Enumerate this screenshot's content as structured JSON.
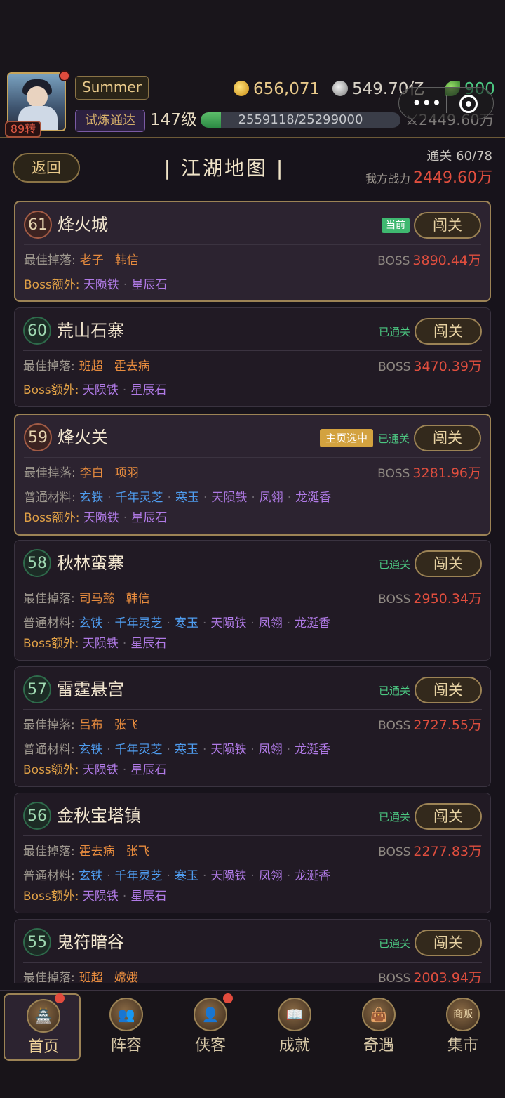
{
  "header": {
    "username": "Summer",
    "reborn": "89转",
    "badge": "试炼通达",
    "level": "147级",
    "xp_text": "2559118/25299000",
    "xp_fraction": 0.1,
    "gold": "656,071",
    "silver": "549.70亿",
    "jade": "900",
    "power": "2449.60万"
  },
  "title_row": {
    "back_label": "返回",
    "title": "| 江湖地图 |",
    "cleared": "通关 60/78",
    "my_power_label": "我方战力",
    "my_power_value": "2449.60万"
  },
  "labels": {
    "best_drop": "最佳掉落:",
    "boss": "BOSS",
    "boss_extra": "Boss额外:",
    "common_mat": "普通材料:",
    "fight": "闯关",
    "tag_current": "当前",
    "tag_home": "主页选中",
    "tag_cleared": "已通关"
  },
  "stages": [
    {
      "num": "61",
      "name": "烽火城",
      "drops": [
        "老子",
        "韩信"
      ],
      "boss": "3890.44万",
      "boss_extra": [
        "天陨铁",
        "星辰石"
      ]
    },
    {
      "num": "60",
      "name": "荒山石寨",
      "drops": [
        "班超",
        "霍去病"
      ],
      "boss": "3470.39万",
      "boss_extra": [
        "天陨铁",
        "星辰石"
      ]
    },
    {
      "num": "59",
      "name": "烽火关",
      "drops": [
        "李白",
        "项羽"
      ],
      "boss": "3281.96万",
      "materials": [
        "玄铁",
        "千年灵芝",
        "寒玉",
        "天陨铁",
        "凤翎",
        "龙涎香"
      ],
      "boss_extra": [
        "天陨铁",
        "星辰石"
      ]
    },
    {
      "num": "58",
      "name": "秋林蛮寨",
      "drops": [
        "司马懿",
        "韩信"
      ],
      "boss": "2950.34万",
      "materials": [
        "玄铁",
        "千年灵芝",
        "寒玉",
        "天陨铁",
        "凤翎",
        "龙涎香"
      ],
      "boss_extra": [
        "天陨铁",
        "星辰石"
      ]
    },
    {
      "num": "57",
      "name": "雷霆悬宫",
      "drops": [
        "吕布",
        "张飞"
      ],
      "boss": "2727.55万",
      "materials": [
        "玄铁",
        "千年灵芝",
        "寒玉",
        "天陨铁",
        "凤翎",
        "龙涎香"
      ],
      "boss_extra": [
        "天陨铁",
        "星辰石"
      ]
    },
    {
      "num": "56",
      "name": "金秋宝塔镇",
      "drops": [
        "霍去病",
        "张飞"
      ],
      "boss": "2277.83万",
      "materials": [
        "玄铁",
        "千年灵芝",
        "寒玉",
        "天陨铁",
        "凤翎",
        "龙涎香"
      ],
      "boss_extra": [
        "天陨铁",
        "星辰石"
      ]
    },
    {
      "num": "55",
      "name": "鬼符暗谷",
      "drops": [
        "班超",
        "嫦娥"
      ],
      "boss": "2003.94万"
    }
  ],
  "nav": [
    {
      "label": "首页",
      "icon": "home-icon",
      "glyph": "🏯"
    },
    {
      "label": "阵容",
      "icon": "team-icon",
      "glyph": "👥"
    },
    {
      "label": "侠客",
      "icon": "hero-icon",
      "glyph": "👤"
    },
    {
      "label": "成就",
      "icon": "book-icon",
      "glyph": "📖"
    },
    {
      "label": "奇遇",
      "icon": "bag-icon",
      "glyph": "👜"
    },
    {
      "label": "集市",
      "icon": "market-icon",
      "glyph": "商贩"
    }
  ]
}
